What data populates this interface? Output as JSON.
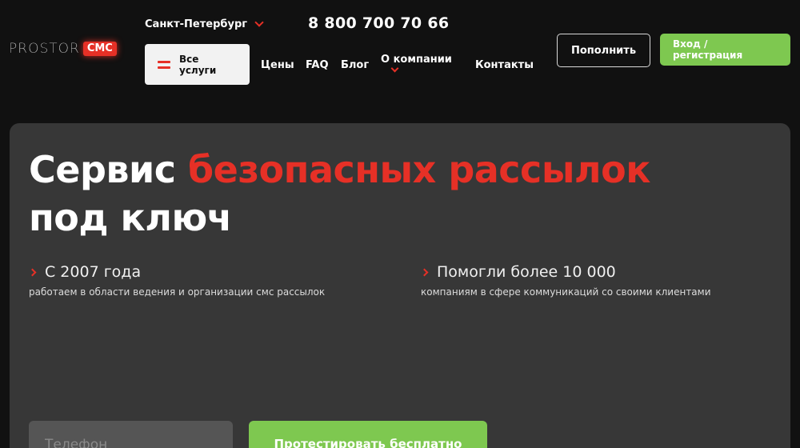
{
  "logo": {
    "text": "PROSTOR",
    "badge": "СМС"
  },
  "header": {
    "city": "Санкт-Петербург",
    "phone": "8 800 700 70 66",
    "all_services": "Все услуги",
    "nav": {
      "prices": "Цены",
      "faq": "FAQ",
      "blog": "Блог",
      "about": "О компании",
      "contacts": "Контакты"
    },
    "topup": "Пополнить",
    "login": "Вход / регистрация"
  },
  "hero": {
    "title_part1": "Сервис ",
    "title_accent": "безопасных рассылок",
    "title_part2": "под ключ",
    "facts": [
      {
        "title": "С 2007 года",
        "desc": "работаем в области ведения и организации смс рассылок"
      },
      {
        "title": "Помогли более 10 000",
        "desc": "компаниям в сфере коммуникаций со своими клиентами"
      }
    ],
    "phone_placeholder": "Телефон",
    "test_button": "Протестировать бесплатно"
  },
  "colors": {
    "accent": "#e63026",
    "green": "#7ec850",
    "background": "#111111",
    "card": "#373737"
  },
  "icons": {
    "city_dropdown": "chevron-down-icon",
    "menu": "hamburger-icon",
    "fact_marker": "chevron-right-icon"
  }
}
